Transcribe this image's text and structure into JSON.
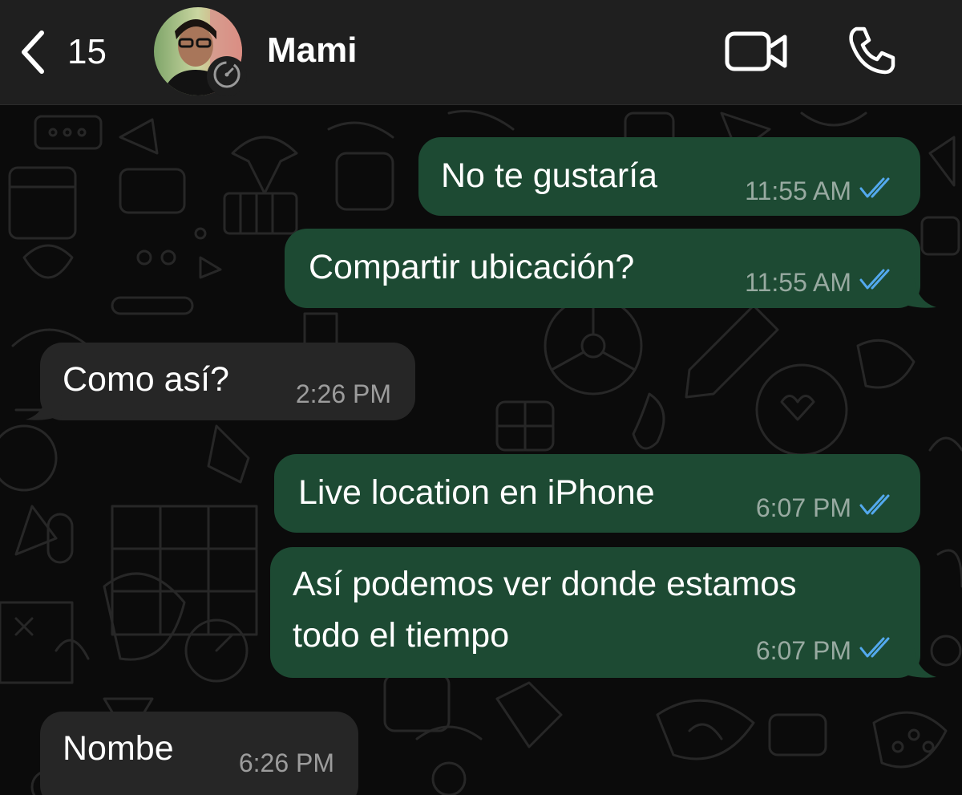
{
  "header": {
    "back_count": "15",
    "contact_name": "Mami"
  },
  "colors": {
    "outgoing_bubble": "#1d4a33",
    "incoming_bubble": "#262626",
    "read_ticks": "#53a9ee",
    "header_bg": "#1f1f1f"
  },
  "icons": [
    "chevron-left-icon",
    "status-timer-icon",
    "video-call-icon",
    "phone-icon",
    "double-check-icon"
  ],
  "messages": [
    {
      "direction": "outgoing",
      "text": "No te gustaría",
      "time": "11:55 AM",
      "read": true
    },
    {
      "direction": "outgoing",
      "text": "Compartir ubicación?",
      "time": "11:55 AM",
      "read": true
    },
    {
      "direction": "incoming",
      "text": "Como así?",
      "time": "2:26 PM"
    },
    {
      "direction": "outgoing",
      "text": "Live location en iPhone",
      "time": "6:07 PM",
      "read": true
    },
    {
      "direction": "outgoing",
      "text_line1": "Así podemos ver donde estamos",
      "text_line2": "todo el tiempo",
      "time": "6:07 PM",
      "read": true
    },
    {
      "direction": "incoming",
      "text": "Nombe",
      "time": "6:26 PM"
    }
  ]
}
